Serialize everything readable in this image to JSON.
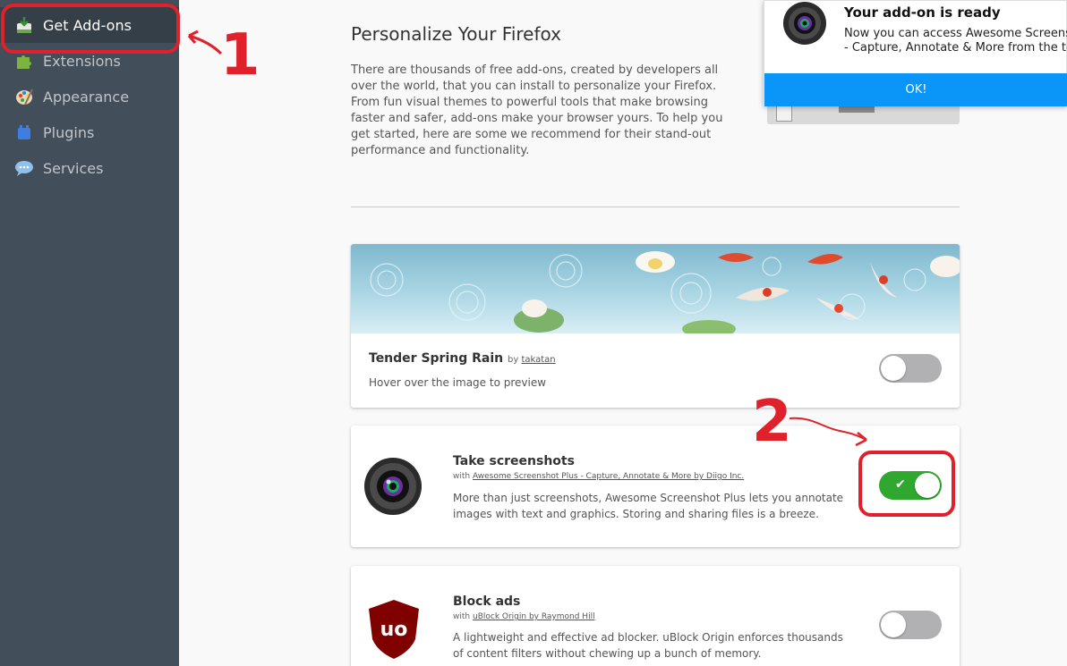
{
  "sidebar": {
    "items": [
      {
        "label": "Get Add-ons",
        "icon": "get-addons-icon"
      },
      {
        "label": "Extensions",
        "icon": "puzzle-icon"
      },
      {
        "label": "Appearance",
        "icon": "palette-icon"
      },
      {
        "label": "Plugins",
        "icon": "plugin-block-icon"
      },
      {
        "label": "Services",
        "icon": "chat-bubble-icon"
      }
    ]
  },
  "annotations": {
    "num1": "1",
    "num2": "2",
    "color": "#e0202a"
  },
  "main": {
    "title": "Personalize Your Firefox",
    "intro": "There are thousands of free add-ons, created by developers all over the world, that you can install to personalize your Firefox. From fun visual themes to powerful tools that make browsing faster and safer, add-ons make your browser yours. To help you get started, here are some we recommend for their stand-out performance and functionality."
  },
  "cards": {
    "theme": {
      "name": "Tender Spring Rain",
      "by": "by",
      "author": "takatan",
      "desc": "Hover over the image to preview",
      "enabled": false
    },
    "screenshot": {
      "name": "Take screenshots",
      "with": "with",
      "addon": "Awesome Screenshot Plus - Capture, Annotate & More by Diigo Inc.",
      "desc": "More than just screenshots, Awesome Screenshot Plus lets you annotate images with text and graphics. Storing and sharing files is a breeze.",
      "enabled": true
    },
    "adblock": {
      "name": "Block ads",
      "with": "with",
      "addon": "uBlock Origin by Raymond Hill",
      "desc": "A lightweight and effective ad blocker. uBlock Origin enforces thousands of content filters without chewing up a bunch of memory.",
      "enabled": false
    }
  },
  "notification": {
    "title": "Your add-on is ready",
    "body_line1": "Now you can access Awesome Screenshot",
    "body_line2": "- Capture, Annotate & More from the toolbar.",
    "ok": "OK!"
  },
  "colors": {
    "sidebar": "#424f5a",
    "toggle_on": "#30a830",
    "ok_button": "#0996f8"
  }
}
